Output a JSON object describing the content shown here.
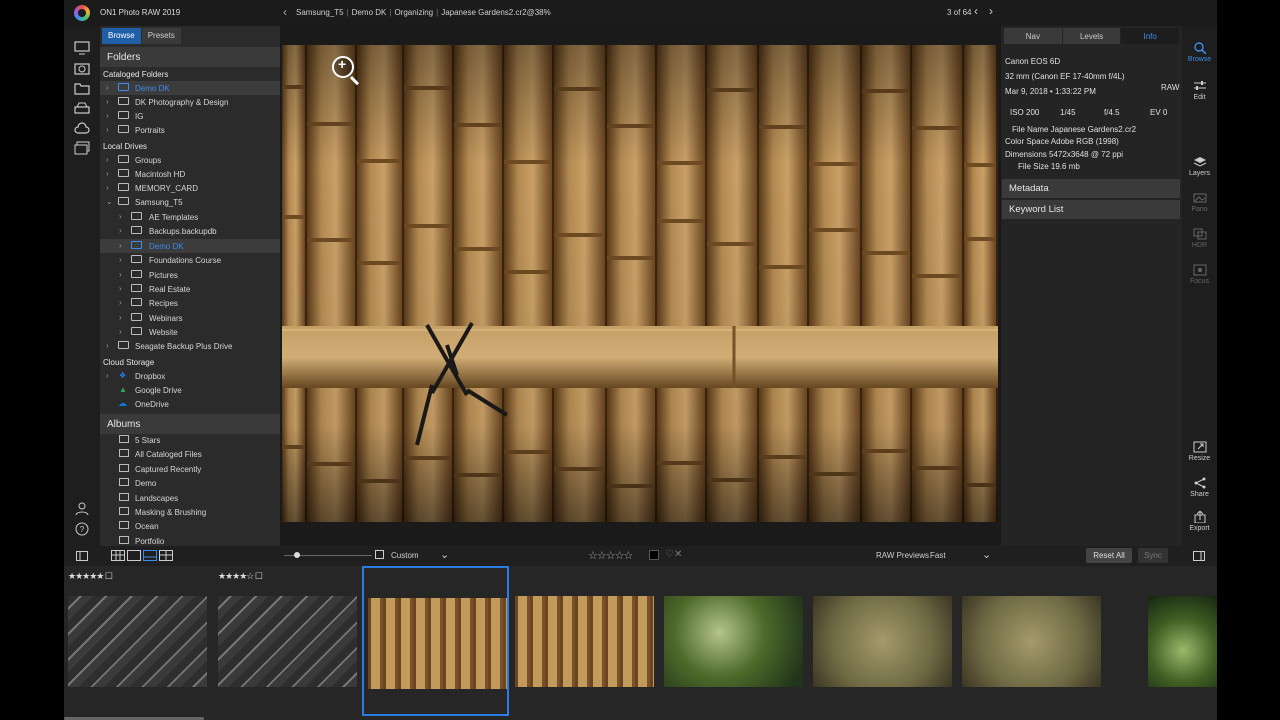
{
  "titlebar": {
    "app_name": "ON1 Photo RAW 2019",
    "breadcrumb": [
      "Samsung_T5",
      "Demo DK",
      "Organizing",
      "Japanese Gardens2.cr2@38%"
    ],
    "counter": "3 of 64"
  },
  "sidebar": {
    "tabs": [
      "Browse",
      "Presets"
    ],
    "folders_title": "Folders",
    "cataloged_label": "Cataloged Folders",
    "cataloged": [
      {
        "label": "Demo DK",
        "selected": true
      },
      {
        "label": "DK Photography & Design"
      },
      {
        "label": "IG"
      },
      {
        "label": "Portraits"
      }
    ],
    "local_label": "Local Drives",
    "local": [
      {
        "label": "Groups"
      },
      {
        "label": "Macintosh HD"
      },
      {
        "label": "MEMORY_CARD"
      },
      {
        "label": "Samsung_T5",
        "expanded": true
      }
    ],
    "samsung_children": [
      {
        "label": "AE Templates"
      },
      {
        "label": "Backups.backupdb"
      },
      {
        "label": "Demo DK",
        "selected": true
      },
      {
        "label": "Foundations Course"
      },
      {
        "label": "Pictures"
      },
      {
        "label": "Real Estate"
      },
      {
        "label": "Recipes"
      },
      {
        "label": "Webinars"
      },
      {
        "label": "Website"
      }
    ],
    "seagate": "Seagate Backup Plus Drive",
    "cloud_label": "Cloud Storage",
    "cloud": [
      {
        "label": "Dropbox",
        "color": "#2d7ff9"
      },
      {
        "label": "Google Drive",
        "color": "#34a853"
      },
      {
        "label": "OneDrive",
        "color": "#0f78d4"
      }
    ],
    "albums_title": "Albums",
    "albums": [
      "5 Stars",
      "All Cataloged Files",
      "Captured Recently",
      "Demo",
      "Landscapes",
      "Masking & Brushing",
      "Ocean",
      "Portfolio"
    ]
  },
  "info_panel": {
    "tabs": [
      "Nav",
      "Levels",
      "Info"
    ],
    "camera": "Canon EOS 6D",
    "lens": "32 mm (Canon EF 17-40mm f/4L)",
    "date": "Mar 9, 2018 • 1:33:22 PM",
    "format": "RAW",
    "exif": {
      "iso": "ISO 200",
      "shutter": "1/45",
      "aperture": "f/4.5",
      "ev": "EV 0"
    },
    "file_name": "File Name Japanese Gardens2.cr2",
    "color_space": "Color Space Adobe RGB (1998)",
    "dimensions": "Dimensions 5472x3648 @ 72 ppi",
    "file_size": "File Size 19.6 mb",
    "metadata_title": "Metadata",
    "keyword_title": "Keyword List"
  },
  "tools": {
    "browse": "Browse",
    "edit": "Edit",
    "layers": "Layers",
    "pano": "Pano",
    "hdr": "HDR",
    "focus": "Focus",
    "resize": "Resize",
    "share": "Share",
    "export": "Export"
  },
  "bottombar": {
    "sort": "Custom",
    "raw_previews_label": "RAW Previews",
    "raw_previews_value": "Fast",
    "reset_all": "Reset All",
    "sync": "Sync"
  },
  "filmstrip": [
    {
      "stars": 5,
      "thumb": "bricks"
    },
    {
      "stars": 4,
      "thumb": "bricks"
    },
    {
      "stars": 0,
      "thumb": "bamboo",
      "selected": true
    },
    {
      "stars": 0,
      "thumb": "bamboo"
    },
    {
      "stars": 0,
      "thumb": "garden"
    },
    {
      "stars": 0,
      "thumb": "texture"
    },
    {
      "stars": 0,
      "thumb": "texture"
    },
    {
      "stars": 0,
      "thumb": "garden2"
    }
  ],
  "colors": {
    "accent": "#2a7be4",
    "panel": "#2b2b2b",
    "header": "#3a3a3a"
  }
}
